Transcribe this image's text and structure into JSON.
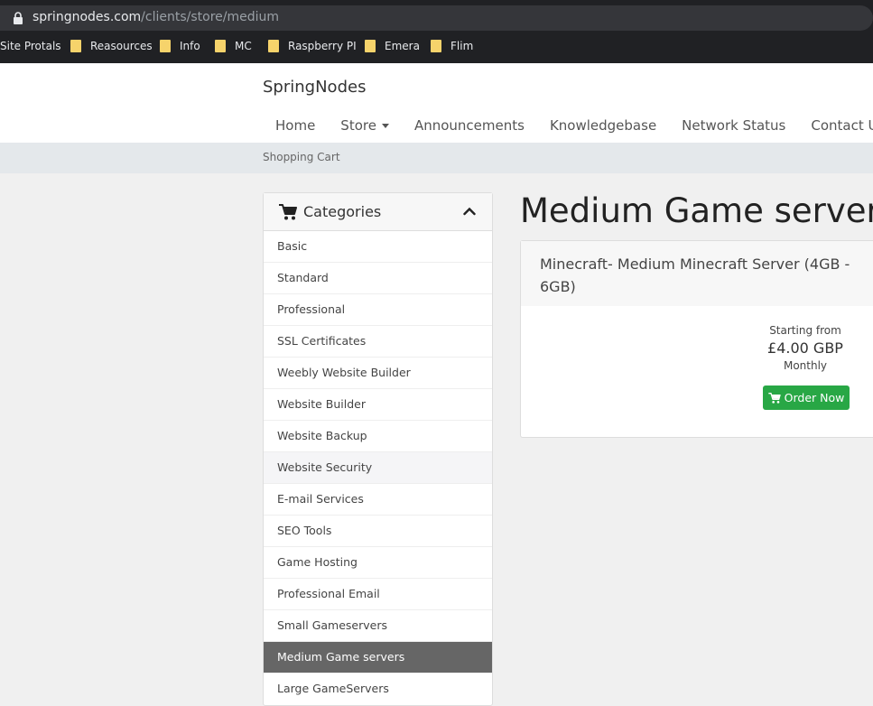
{
  "browser": {
    "url_host": "springnodes.com",
    "url_path": "/clients/store/medium",
    "bookmarks": [
      {
        "label": "Site Protals",
        "folder": false
      },
      {
        "label": "Reasources",
        "folder": true
      },
      {
        "label": "Info",
        "folder": true
      },
      {
        "label": "MC",
        "folder": true
      },
      {
        "label": "Raspberry PI",
        "folder": true
      },
      {
        "label": "Emera",
        "folder": true
      },
      {
        "label": "Flim",
        "folder": true
      }
    ]
  },
  "header": {
    "brand": "SpringNodes",
    "nav": [
      "Home",
      "Store",
      "Announcements",
      "Knowledgebase",
      "Network Status",
      "Contact Us"
    ],
    "breadcrumb": "Shopping Cart"
  },
  "sidebar": {
    "title": "Categories",
    "items": [
      "Basic",
      "Standard",
      "Professional",
      "SSL Certificates",
      "Weebly Website Builder",
      "Website Builder",
      "Website Backup",
      "Website Security",
      "E-mail Services",
      "SEO Tools",
      "Game Hosting",
      "Professional Email",
      "Small Gameservers",
      "Medium Game servers",
      "Large GameServers"
    ],
    "active_index": 13,
    "hover_index": 7
  },
  "main": {
    "title": "Medium Game servers",
    "product": {
      "name": "Minecraft- Medium Minecraft Server (4GB - 6GB)",
      "starting_from": "Starting from",
      "price": "£4.00 GBP",
      "cycle": "Monthly",
      "order_label": "Order Now"
    }
  },
  "colors": {
    "accent_green": "#28a745",
    "active_item": "#666666",
    "folder_yellow": "#f6d36b"
  }
}
